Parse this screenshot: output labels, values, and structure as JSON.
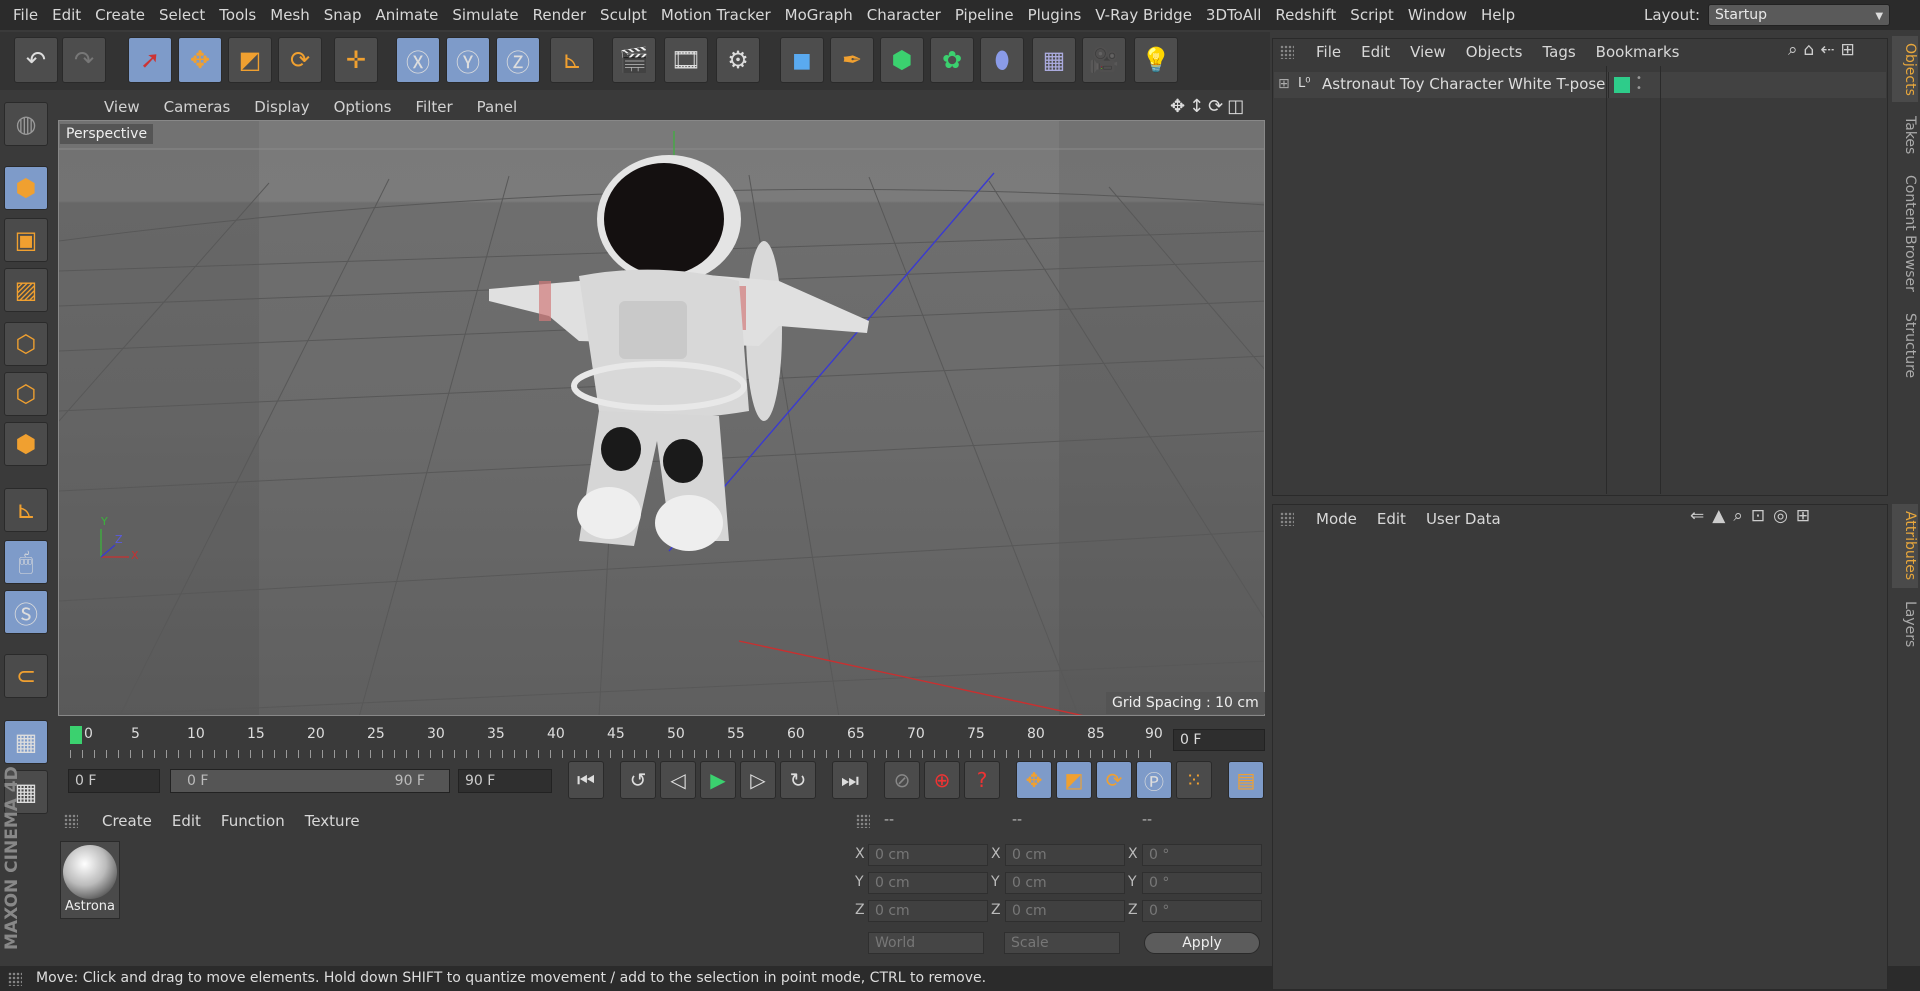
{
  "menubar": {
    "items": [
      "File",
      "Edit",
      "Create",
      "Select",
      "Tools",
      "Mesh",
      "Snap",
      "Animate",
      "Simulate",
      "Render",
      "Sculpt",
      "Motion Tracker",
      "MoGraph",
      "Character",
      "Pipeline",
      "Plugins",
      "V-Ray Bridge",
      "3DToAll",
      "Redshift",
      "Script",
      "Window",
      "Help"
    ],
    "layout_label": "Layout:",
    "layout_value": "Startup"
  },
  "viewport": {
    "menu": [
      "View",
      "Cameras",
      "Display",
      "Options",
      "Filter",
      "Panel"
    ],
    "camera_label": "Perspective",
    "grid_spacing": "Grid Spacing : 10 cm",
    "axis_y": "Y",
    "axis_z": "Z",
    "axis_x": "X"
  },
  "timeline": {
    "ticks": [
      "0",
      "5",
      "10",
      "15",
      "20",
      "25",
      "30",
      "35",
      "40",
      "45",
      "50",
      "55",
      "60",
      "65",
      "70",
      "75",
      "80",
      "85",
      "90"
    ],
    "current_frame": "0 F",
    "start_field": "0 F",
    "range_start": "0 F",
    "range_end": "90 F",
    "end_field": "90 F"
  },
  "material": {
    "menu": [
      "Create",
      "Edit",
      "Function",
      "Texture"
    ],
    "swatch_label": "Astrona"
  },
  "coords": {
    "headers": [
      "--",
      "--",
      "--"
    ],
    "rows": [
      {
        "axis": "X",
        "pos": "0 cm",
        "size": "0 cm",
        "rot": "0 °"
      },
      {
        "axis": "Y",
        "pos": "0 cm",
        "size": "0 cm",
        "rot": "0 °"
      },
      {
        "axis": "Z",
        "pos": "0 cm",
        "size": "0 cm",
        "rot": "0 °"
      }
    ],
    "mode_select": "World",
    "scale_select": "Scale",
    "apply_label": "Apply"
  },
  "objects": {
    "menu": [
      "File",
      "Edit",
      "View",
      "Objects",
      "Tags",
      "Bookmarks"
    ],
    "item_name": "Astronaut Toy Character White T-pose",
    "tag_color": "#2ecc8a"
  },
  "attributes": {
    "menu": [
      "Mode",
      "Edit",
      "User Data"
    ]
  },
  "side_tabs": {
    "top": [
      "Objects",
      "Takes",
      "Content Browser",
      "Structure"
    ],
    "bottom": [
      "Attributes",
      "Layers"
    ]
  },
  "brand": "MAXON CINEMA 4D",
  "status": "Move: Click and drag to move elements. Hold down SHIFT to quantize movement / add to the selection in point mode, CTRL to remove.",
  "colors": {
    "accent_blue": "#7e9bc9",
    "accent_orange": "#e8a73c",
    "ok_green": "#2ecc8a"
  }
}
